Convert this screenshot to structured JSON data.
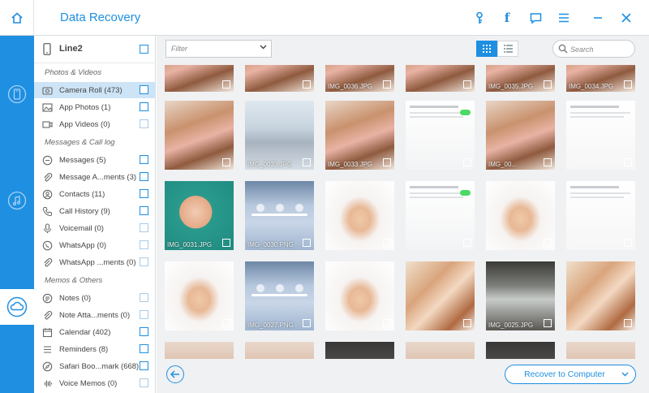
{
  "app": {
    "title": "Data Recovery"
  },
  "device": {
    "name": "Line2"
  },
  "sections": {
    "photos": "Photos & Videos",
    "messages": "Messages & Call log",
    "memos": "Memos & Others"
  },
  "categories": [
    {
      "label": "Camera Roll (473)",
      "icon": "camera-icon"
    },
    {
      "label": "App Photos (1)",
      "icon": "image-icon"
    },
    {
      "label": "App Videos (0)",
      "icon": "video-icon"
    },
    {
      "label": "Messages (5)",
      "icon": "message-icon"
    },
    {
      "label": "Message A...ments (3)",
      "icon": "paperclip-icon"
    },
    {
      "label": "Contacts (11)",
      "icon": "contacts-icon"
    },
    {
      "label": "Call History (9)",
      "icon": "phone-icon"
    },
    {
      "label": "Voicemail (0)",
      "icon": "voicemail-icon"
    },
    {
      "label": "WhatsApp (0)",
      "icon": "whatsapp-icon"
    },
    {
      "label": "WhatsApp ...ments (0)",
      "icon": "paperclip-icon"
    },
    {
      "label": "Notes (0)",
      "icon": "notes-icon"
    },
    {
      "label": "Note Atta...ments (0)",
      "icon": "paperclip-icon"
    },
    {
      "label": "Calendar (402)",
      "icon": "calendar-icon"
    },
    {
      "label": "Reminders (8)",
      "icon": "reminders-icon"
    },
    {
      "label": "Safari Boo...mark (668)",
      "icon": "safari-icon"
    },
    {
      "label": "Voice Memos (0)",
      "icon": "voice-memo-icon"
    }
  ],
  "toolbar": {
    "filter_placeholder": "Filter",
    "search_placeholder": "Search"
  },
  "thumbnails": [
    {
      "caption": "",
      "kind": "party"
    },
    {
      "caption": "",
      "kind": "party"
    },
    {
      "caption": "IMG_0036.JPG",
      "kind": "party"
    },
    {
      "caption": "",
      "kind": "party"
    },
    {
      "caption": "IMG_0035.JPG",
      "kind": "party"
    },
    {
      "caption": "IMG_0034.JPG",
      "kind": "party"
    },
    {
      "caption": "",
      "kind": "party"
    },
    {
      "caption": "IMG_0033.JPG",
      "kind": "group"
    },
    {
      "caption": "IMG_0033.JPG",
      "kind": "party"
    },
    {
      "caption": "",
      "kind": "settings"
    },
    {
      "caption": "IMG_00...",
      "kind": "party"
    },
    {
      "caption": "",
      "kind": "doc"
    },
    {
      "caption": "IMG_0031.JPG",
      "kind": "baby-teal"
    },
    {
      "caption": "IMG_0030.PNG",
      "kind": "phone"
    },
    {
      "caption": "",
      "kind": "baby-white"
    },
    {
      "caption": "",
      "kind": "settings"
    },
    {
      "caption": "",
      "kind": "baby-white"
    },
    {
      "caption": "",
      "kind": "doc"
    },
    {
      "caption": "",
      "kind": "baby-white"
    },
    {
      "caption": "IMG_0027.PNG",
      "kind": "phone"
    },
    {
      "caption": "",
      "kind": "baby-white"
    },
    {
      "caption": "",
      "kind": "mom-baby"
    },
    {
      "caption": "IMG_0025.JPG",
      "kind": "window"
    },
    {
      "caption": "",
      "kind": "mom-baby"
    },
    {
      "caption": "",
      "kind": "partial"
    },
    {
      "caption": "",
      "kind": "partial"
    },
    {
      "caption": "",
      "kind": "partial-dark"
    },
    {
      "caption": "",
      "kind": "partial"
    },
    {
      "caption": "",
      "kind": "partial-dark"
    },
    {
      "caption": "",
      "kind": "partial"
    }
  ],
  "footer": {
    "recover_label": "Recover to Computer"
  },
  "colors": {
    "accent": "#1e8fe1",
    "selected_row": "#cde4f6"
  }
}
